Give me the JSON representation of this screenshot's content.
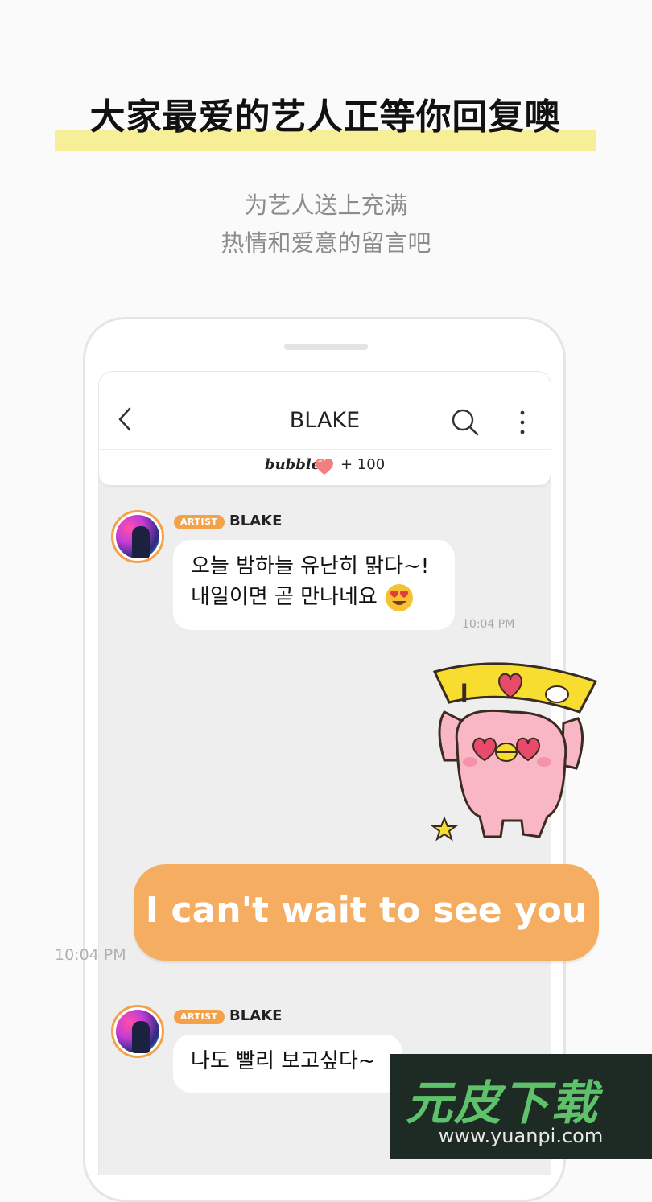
{
  "headline": "大家最爱的艺人正等你回复噢",
  "subtitle": [
    "为艺人送上充满",
    "热情和爱意的留言吧"
  ],
  "chat": {
    "title": "BLAKE",
    "bubble_logo": "bubble",
    "bubble_count": "+ 100",
    "messages": [
      {
        "badge": "ARTIST",
        "sender": "BLAKE",
        "lines": [
          "오늘 밤하늘 유난히 맑다~!",
          "내일이면 곧 만나네요"
        ],
        "time": "10:04 PM"
      },
      {
        "badge": "ARTIST",
        "sender": "BLAKE",
        "lines": [
          "나도 빨리 보고싶다~"
        ]
      }
    ],
    "reply": {
      "text": "I can't wait to see you",
      "time": "10:04 PM"
    },
    "sticker_sign": "I"
  },
  "watermark": {
    "title": "元皮下载",
    "url": "www.yuanpi.com"
  },
  "icons": [
    "back-icon",
    "search-icon",
    "more-icon",
    "heart-icon",
    "heart-eyes-emoji-icon"
  ],
  "colors": {
    "accent": "#f4a24a",
    "reply_bubble": "#f5ad62",
    "highlight": "#f7ee98"
  }
}
